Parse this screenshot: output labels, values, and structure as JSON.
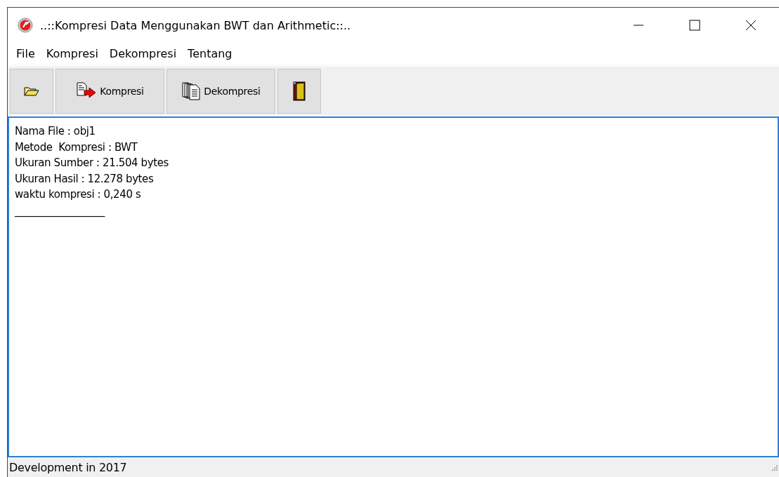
{
  "window": {
    "title": "..::Kompresi Data Menggunakan BWT dan Arithmetic::.."
  },
  "menu": [
    "File",
    "Kompresi",
    "Dekompresi",
    "Tentang"
  ],
  "toolbar": [
    {
      "kind": "open"
    },
    {
      "kind": "compress",
      "label": "Kompresi"
    },
    {
      "kind": "decompress",
      "label": "Dekompresi"
    },
    {
      "kind": "exit"
    }
  ],
  "memo": {
    "lines": [
      "Nama File : obj1",
      "Metode  Kompresi : BWT",
      "Ukuran Sumber : 21.504 bytes",
      "Ukuran Hasil : 12.278 bytes",
      "waktu kompresi : 0,240 s",
      "__________________"
    ]
  },
  "status_bar": "Development in 2017"
}
